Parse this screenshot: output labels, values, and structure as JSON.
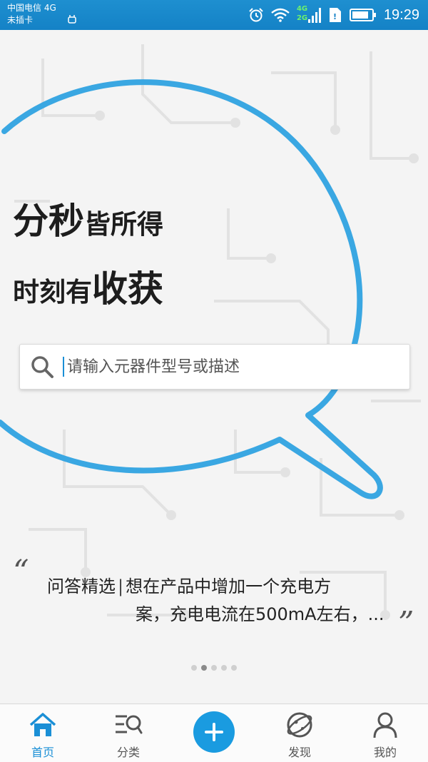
{
  "status_bar": {
    "carrier": "中国电信 4G",
    "sim_status": "未插卡",
    "network_4g": "4G",
    "network_2g": "2G",
    "time": "19:29",
    "icons": [
      "usb-debug-icon",
      "alarm-icon",
      "wifi-icon",
      "signal-icon",
      "sim-icon",
      "battery-icon"
    ]
  },
  "hero": {
    "slogan_line1_big": "分秒",
    "slogan_line1_small": "皆所得",
    "slogan_line2_small": "时刻有",
    "slogan_line2_big": "收获"
  },
  "search": {
    "placeholder": "请输入元器件型号或描述",
    "value": ""
  },
  "qa": {
    "open_quote": "“",
    "close_quote": "”",
    "label": "问答精选",
    "separator": "|",
    "text_line1": "想在产品中增加一个充电方",
    "text_line2": "案，充电电流在500mA左右，..."
  },
  "carousel": {
    "count": 5,
    "active_index": 1
  },
  "tabs": [
    {
      "label": "首页",
      "icon": "home-icon",
      "active": true
    },
    {
      "label": "分类",
      "icon": "category-search-icon",
      "active": false
    },
    {
      "label": "",
      "icon": "add-icon",
      "active": false
    },
    {
      "label": "发现",
      "icon": "planet-icon",
      "active": false
    },
    {
      "label": "我的",
      "icon": "user-icon",
      "active": false
    }
  ],
  "colors": {
    "accent": "#1a8fd6",
    "status_bar": "#1482c6",
    "ring": "#3aa7e2"
  }
}
